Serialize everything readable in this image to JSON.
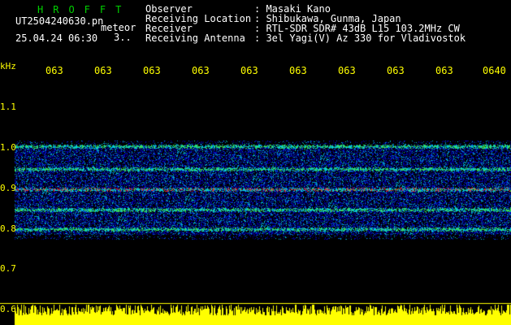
{
  "header": {
    "logo": "HROFFT",
    "filename": "UT2504240630.pn",
    "meteor_label": "meteor",
    "datetime": "25.04.24 06:30",
    "datetime_extra": "3..",
    "fields": [
      {
        "label": "Observer",
        "value": ": Masaki Kano"
      },
      {
        "label": "Receiving Location",
        "value": ": Shibukawa, Gunma, Japan"
      },
      {
        "label": "Receiver",
        "value": ": RTL-SDR SDR# 43dB L15 103.2MHz CW"
      },
      {
        "label": "Receiving Antenna",
        "value": ": 3el Yagi(V) Az 330 for Vladivostok"
      }
    ]
  },
  "axis": {
    "y_unit": "kHz",
    "x_ticks": [
      "063",
      "063",
      "063",
      "063",
      "063",
      "063",
      "063",
      "063",
      "063",
      "0640"
    ],
    "y_ticks": [
      "1.1",
      "1.0",
      "0.9",
      "0.8",
      "0.7",
      "0.6"
    ]
  },
  "colors": {
    "background": "#000000",
    "axis_text": "#ffff00",
    "logo": "#00d000",
    "header_text": "#ffffff"
  }
}
